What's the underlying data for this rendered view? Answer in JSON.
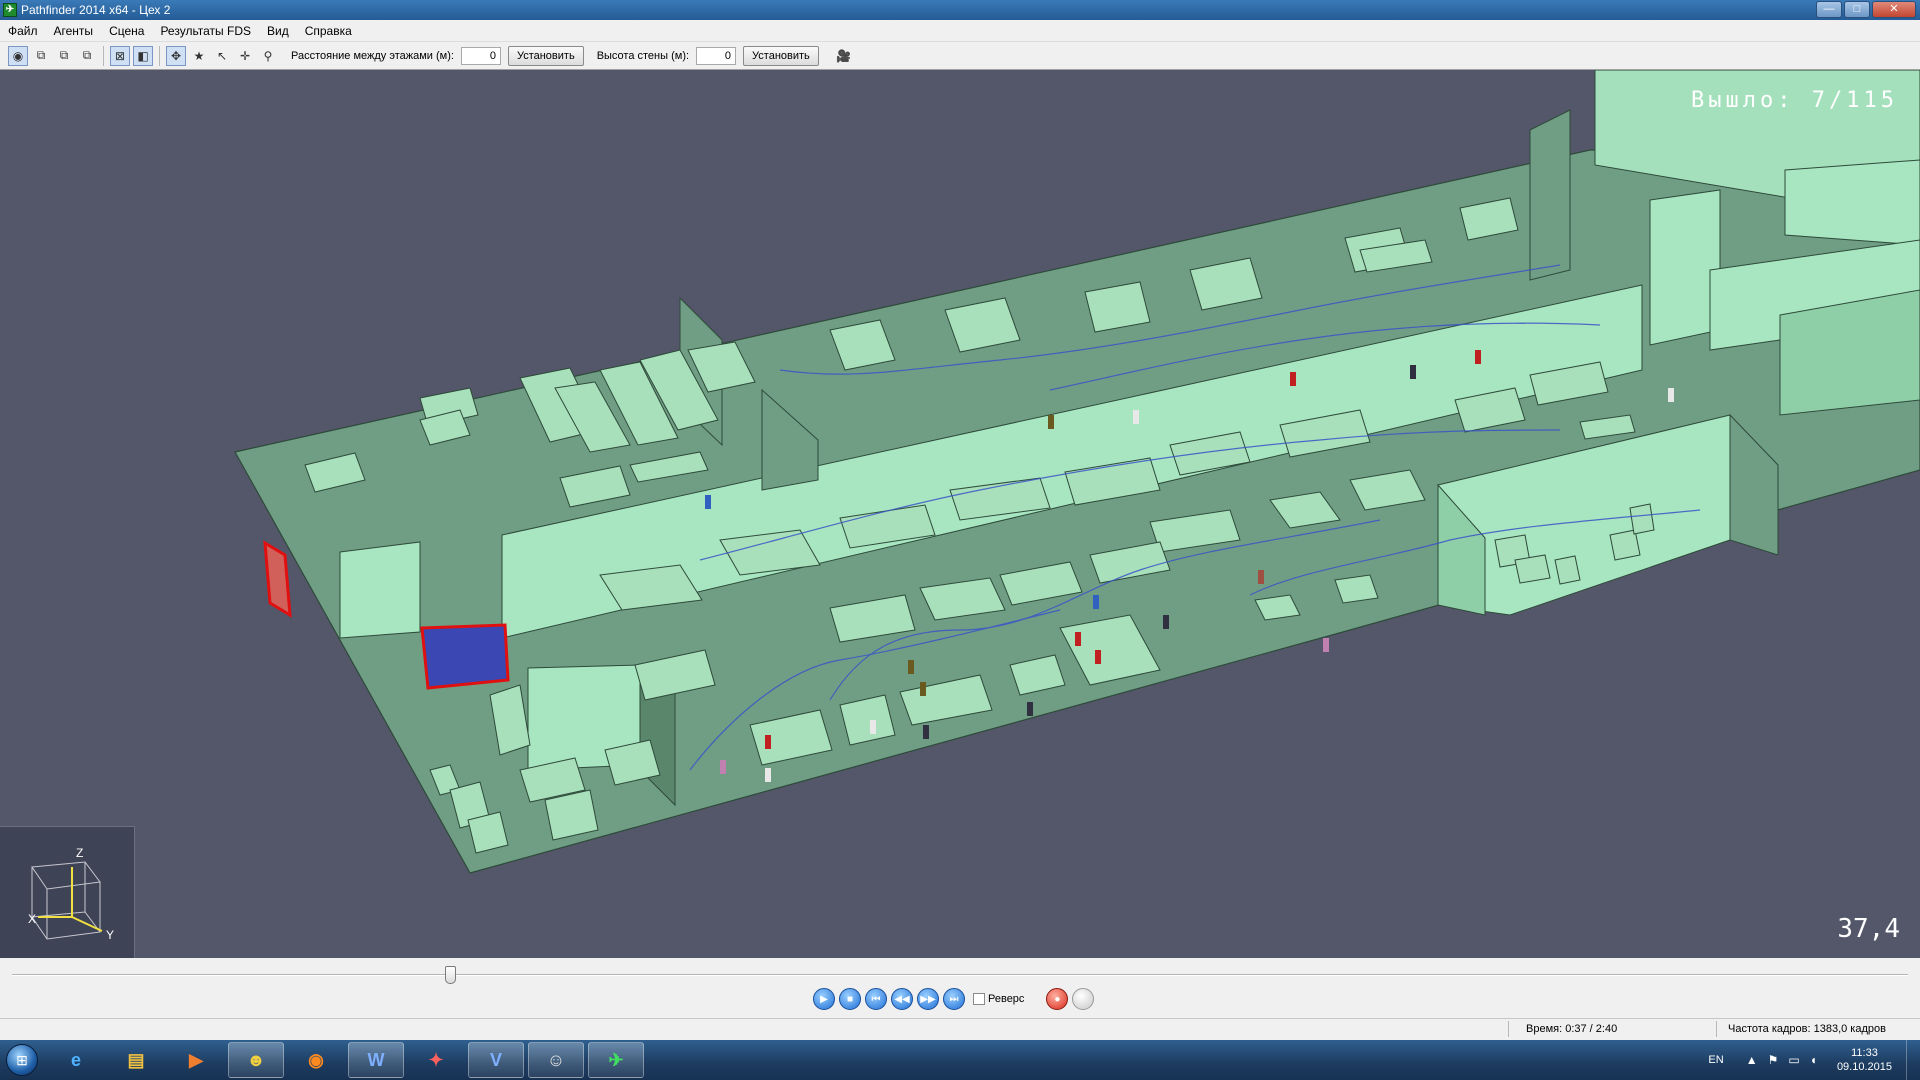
{
  "window": {
    "title": "Pathfinder 2014 x64 - Цех 2",
    "app_icon": "running-man-icon",
    "controls": [
      "minimize",
      "maximize",
      "close"
    ]
  },
  "menu": [
    "Файл",
    "Агенты",
    "Сцена",
    "Результаты FDS",
    "Вид",
    "Справка"
  ],
  "toolbar": {
    "floor_label": "Расстояние между этажами (м):",
    "floor_value": "0",
    "floor_set": "Установить",
    "wall_label": "Высота стены (м):",
    "wall_value": "0",
    "wall_set": "Установить"
  },
  "viewport": {
    "exited_label": "Вышло:",
    "exited_value": "7/115",
    "fps": "37,4",
    "axes": {
      "x": "X",
      "y": "Y",
      "z": "Z"
    },
    "colors": {
      "background": "#545769",
      "floor": "#6f9e84",
      "obstacle_top": "#a8e0bb",
      "wall": "#a7e6c0",
      "exit": "#e01010",
      "door": "#3b47b3"
    }
  },
  "playback": {
    "reverse_label": "Реверс",
    "reverse_checked": false,
    "progress": 0.231
  },
  "status": {
    "time": "Время: 0:37 / 2:40",
    "frame_rate": "Частота кадров: 1383,0 кадров"
  },
  "taskbar": {
    "lang": "EN",
    "time": "11:33",
    "date": "09.10.2015",
    "apps": [
      "ie-icon",
      "explorer-icon",
      "media-player-icon",
      "batman-icon",
      "firefox-icon",
      "word-icon",
      "acrobat-icon",
      "visio-icon",
      "avatar-app-icon",
      "pathfinder-icon"
    ]
  }
}
